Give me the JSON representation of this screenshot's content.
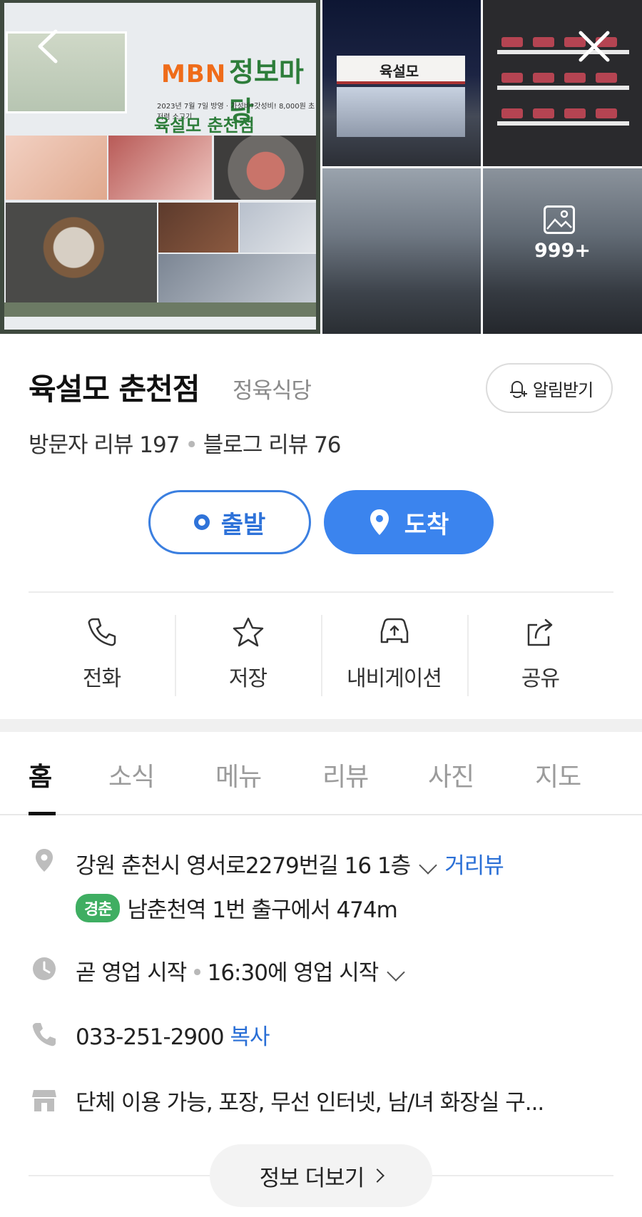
{
  "gallery": {
    "collage_brand": "MBN",
    "collage_show": "정보마당",
    "collage_sub": "2023년 7월 7일 방영 · 가성비?갓성비! 8,000원 초저렴 소고기",
    "collage_shop": "육설모 춘천점",
    "storefront_sign": "육설모",
    "more_count": "999+"
  },
  "place": {
    "name": "육설모 춘천점",
    "category": "정육식당",
    "alert_label": "알림받기",
    "visitor_reviews": "방문자 리뷰 197",
    "blog_reviews": "블로그 리뷰 76"
  },
  "route": {
    "depart_label": "출발",
    "arrive_label": "도착"
  },
  "actions": [
    {
      "label": "전화",
      "icon": "phone-icon"
    },
    {
      "label": "저장",
      "icon": "star-icon"
    },
    {
      "label": "내비게이션",
      "icon": "car-icon"
    },
    {
      "label": "공유",
      "icon": "share-icon"
    }
  ],
  "tabs": [
    "홈",
    "소식",
    "메뉴",
    "리뷰",
    "사진",
    "지도"
  ],
  "info": {
    "address": "강원 춘천시 영서로2279번길 16 1층",
    "street_view": "거리뷰",
    "subway_line": "경춘",
    "subway_directions": "남춘천역 1번 출구에서 474m",
    "hours_status": "곧 영업 시작",
    "hours_detail": "16:30에 영업 시작",
    "phone": "033-251-2900",
    "copy_label": "복사",
    "amenities": "단체 이용 가능, 포장, 무선 인터넷, 남/녀 화장실 구...",
    "more_label": "정보 더보기"
  },
  "colors": {
    "accent_blue": "#3b84ee",
    "subway_green": "#3fae62"
  }
}
